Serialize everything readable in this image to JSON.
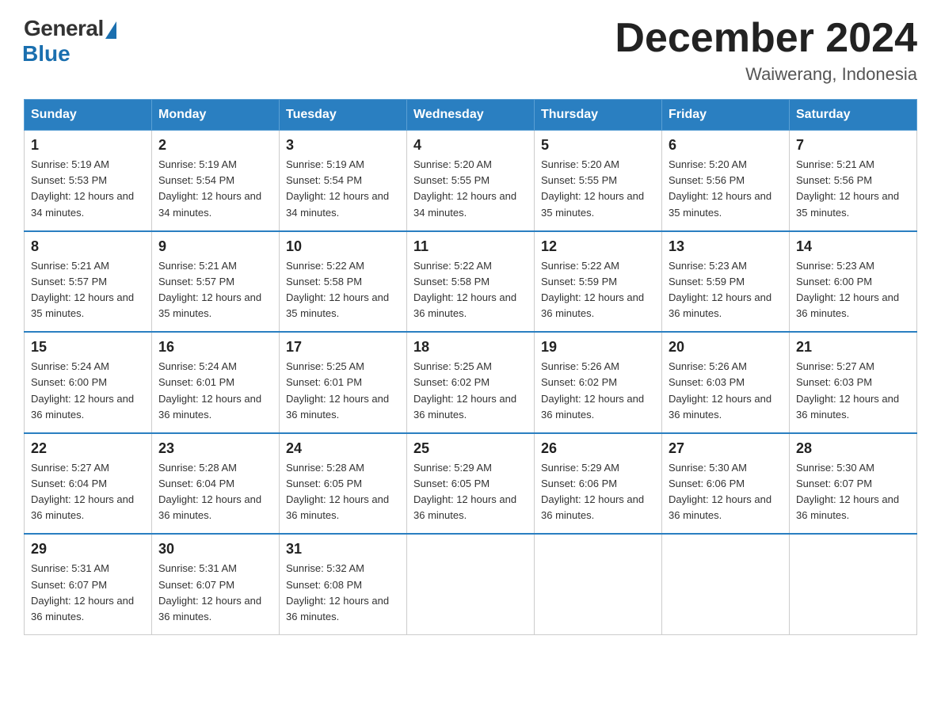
{
  "header": {
    "logo_general": "General",
    "logo_blue": "Blue",
    "month_title": "December 2024",
    "location": "Waiwerang, Indonesia"
  },
  "days_of_week": [
    "Sunday",
    "Monday",
    "Tuesday",
    "Wednesday",
    "Thursday",
    "Friday",
    "Saturday"
  ],
  "weeks": [
    [
      {
        "day": "1",
        "sunrise": "5:19 AM",
        "sunset": "5:53 PM",
        "daylight": "12 hours and 34 minutes."
      },
      {
        "day": "2",
        "sunrise": "5:19 AM",
        "sunset": "5:54 PM",
        "daylight": "12 hours and 34 minutes."
      },
      {
        "day": "3",
        "sunrise": "5:19 AM",
        "sunset": "5:54 PM",
        "daylight": "12 hours and 34 minutes."
      },
      {
        "day": "4",
        "sunrise": "5:20 AM",
        "sunset": "5:55 PM",
        "daylight": "12 hours and 34 minutes."
      },
      {
        "day": "5",
        "sunrise": "5:20 AM",
        "sunset": "5:55 PM",
        "daylight": "12 hours and 35 minutes."
      },
      {
        "day": "6",
        "sunrise": "5:20 AM",
        "sunset": "5:56 PM",
        "daylight": "12 hours and 35 minutes."
      },
      {
        "day": "7",
        "sunrise": "5:21 AM",
        "sunset": "5:56 PM",
        "daylight": "12 hours and 35 minutes."
      }
    ],
    [
      {
        "day": "8",
        "sunrise": "5:21 AM",
        "sunset": "5:57 PM",
        "daylight": "12 hours and 35 minutes."
      },
      {
        "day": "9",
        "sunrise": "5:21 AM",
        "sunset": "5:57 PM",
        "daylight": "12 hours and 35 minutes."
      },
      {
        "day": "10",
        "sunrise": "5:22 AM",
        "sunset": "5:58 PM",
        "daylight": "12 hours and 35 minutes."
      },
      {
        "day": "11",
        "sunrise": "5:22 AM",
        "sunset": "5:58 PM",
        "daylight": "12 hours and 36 minutes."
      },
      {
        "day": "12",
        "sunrise": "5:22 AM",
        "sunset": "5:59 PM",
        "daylight": "12 hours and 36 minutes."
      },
      {
        "day": "13",
        "sunrise": "5:23 AM",
        "sunset": "5:59 PM",
        "daylight": "12 hours and 36 minutes."
      },
      {
        "day": "14",
        "sunrise": "5:23 AM",
        "sunset": "6:00 PM",
        "daylight": "12 hours and 36 minutes."
      }
    ],
    [
      {
        "day": "15",
        "sunrise": "5:24 AM",
        "sunset": "6:00 PM",
        "daylight": "12 hours and 36 minutes."
      },
      {
        "day": "16",
        "sunrise": "5:24 AM",
        "sunset": "6:01 PM",
        "daylight": "12 hours and 36 minutes."
      },
      {
        "day": "17",
        "sunrise": "5:25 AM",
        "sunset": "6:01 PM",
        "daylight": "12 hours and 36 minutes."
      },
      {
        "day": "18",
        "sunrise": "5:25 AM",
        "sunset": "6:02 PM",
        "daylight": "12 hours and 36 minutes."
      },
      {
        "day": "19",
        "sunrise": "5:26 AM",
        "sunset": "6:02 PM",
        "daylight": "12 hours and 36 minutes."
      },
      {
        "day": "20",
        "sunrise": "5:26 AM",
        "sunset": "6:03 PM",
        "daylight": "12 hours and 36 minutes."
      },
      {
        "day": "21",
        "sunrise": "5:27 AM",
        "sunset": "6:03 PM",
        "daylight": "12 hours and 36 minutes."
      }
    ],
    [
      {
        "day": "22",
        "sunrise": "5:27 AM",
        "sunset": "6:04 PM",
        "daylight": "12 hours and 36 minutes."
      },
      {
        "day": "23",
        "sunrise": "5:28 AM",
        "sunset": "6:04 PM",
        "daylight": "12 hours and 36 minutes."
      },
      {
        "day": "24",
        "sunrise": "5:28 AM",
        "sunset": "6:05 PM",
        "daylight": "12 hours and 36 minutes."
      },
      {
        "day": "25",
        "sunrise": "5:29 AM",
        "sunset": "6:05 PM",
        "daylight": "12 hours and 36 minutes."
      },
      {
        "day": "26",
        "sunrise": "5:29 AM",
        "sunset": "6:06 PM",
        "daylight": "12 hours and 36 minutes."
      },
      {
        "day": "27",
        "sunrise": "5:30 AM",
        "sunset": "6:06 PM",
        "daylight": "12 hours and 36 minutes."
      },
      {
        "day": "28",
        "sunrise": "5:30 AM",
        "sunset": "6:07 PM",
        "daylight": "12 hours and 36 minutes."
      }
    ],
    [
      {
        "day": "29",
        "sunrise": "5:31 AM",
        "sunset": "6:07 PM",
        "daylight": "12 hours and 36 minutes."
      },
      {
        "day": "30",
        "sunrise": "5:31 AM",
        "sunset": "6:07 PM",
        "daylight": "12 hours and 36 minutes."
      },
      {
        "day": "31",
        "sunrise": "5:32 AM",
        "sunset": "6:08 PM",
        "daylight": "12 hours and 36 minutes."
      },
      null,
      null,
      null,
      null
    ]
  ]
}
